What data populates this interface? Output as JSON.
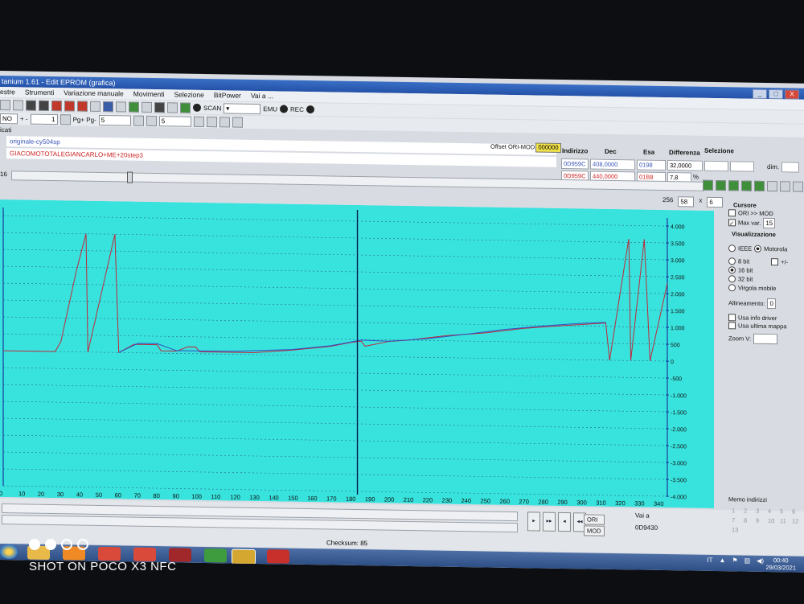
{
  "window": {
    "title": "tanium 1.61 - Edit EPROM (grafica)",
    "controls": [
      "_",
      "□",
      "X"
    ]
  },
  "menu": [
    "estre",
    "Strumenti",
    "Variazione manuale",
    "Movimenti",
    "Selezione",
    "BitPower",
    "Vai a ..."
  ],
  "toolbar1": {
    "scan_label": "SCAN",
    "emu_label": "EMU",
    "rec_label": "REC"
  },
  "toolbar2": {
    "mode_value": "NO",
    "plus_minus": "+ -",
    "step_value": "1",
    "pg_label": "Pg+ Pg-",
    "pg_value": "5",
    "field3_value": "5"
  },
  "section_label": "icati",
  "files": {
    "ori": "originale-cy504sp",
    "mod": "GIACOMOTOTALEGIANCARLO+ME+20step3"
  },
  "offset": {
    "label": "Offset ORI-MOD",
    "value": "000000"
  },
  "table": {
    "headers": [
      "Indirizzo",
      "Dec",
      "Esa",
      "Differenza"
    ],
    "rows": [
      {
        "addr": "0D959C",
        "dec": "408,0000",
        "esa": "0198",
        "diff": "32,0000"
      },
      {
        "addr": "0D959C",
        "dec": "440,0000",
        "esa": "01B8",
        "diff": "7,8",
        "pct": "%"
      }
    ]
  },
  "selezione": {
    "title": "Selezione",
    "dim_label": "dim."
  },
  "slider_label": "16",
  "zoom": {
    "a": "256",
    "b": "58",
    "x": "x",
    "c": "6"
  },
  "right_panel": {
    "cursore_title": "Cursore",
    "ori_mod": "ORI >> MOD",
    "max_var_label": "Max var.",
    "max_var_value": "15",
    "visual_title": "Visualizzazione",
    "ieee": "IEEE",
    "motorola": "Motorola",
    "bit8": "8 bit",
    "bit16": "16 bit",
    "bit32": "32 bit",
    "plusminus": "+/-",
    "virgola": "Virgola mobile",
    "allineamento_label": "Allineamento:",
    "allineamento_value": "0",
    "usa_info": "Usa info driver",
    "usa_ultima": "Usa ultima mappa",
    "zoom_v": "Zoom V:"
  },
  "bottom": {
    "ori_btn": "ORI",
    "mod_btn": "MOD",
    "vai_a_label": "Vai a",
    "vai_a_value": "0D9430",
    "memo_title": "Memo indirizzi",
    "memo_numbers": [
      "1",
      "2",
      "3",
      "4",
      "5",
      "6",
      "7",
      "8",
      "9",
      "10",
      "11",
      "12",
      "13"
    ],
    "checksum": "Checksum: 85"
  },
  "taskbar": {
    "lang": "IT",
    "time": "00:40",
    "date": "29/03/2021"
  },
  "watermark": "SHOT ON POCO X3 NFC",
  "chart_data": {
    "type": "line",
    "x_ticks": [
      0,
      10,
      20,
      30,
      40,
      50,
      60,
      70,
      80,
      90,
      100,
      110,
      120,
      130,
      140,
      150,
      160,
      170,
      180,
      190,
      200,
      210,
      220,
      230,
      240,
      250,
      260,
      270,
      280,
      290,
      300,
      310,
      320,
      330,
      340
    ],
    "y_right_ticks": [
      "4.000",
      "3.500",
      "3.000",
      "2.500",
      "2.000",
      "1.500",
      "1.000",
      "500",
      "0",
      "-500",
      "-1.000",
      "-1.500",
      "-2.000",
      "-2.500",
      "-3.000",
      "-3.500",
      "-4.000"
    ],
    "ylim": [
      -4000,
      4000
    ],
    "xlim": [
      0,
      345
    ],
    "cursor_x": 184,
    "series": [
      {
        "color": "#c0283a",
        "points": [
          [
            0,
            0
          ],
          [
            27,
            0
          ],
          [
            30,
            300
          ],
          [
            38,
            2400
          ],
          [
            43,
            3500
          ],
          [
            44,
            0
          ],
          [
            58,
            3500
          ],
          [
            60,
            0
          ],
          [
            68,
            250
          ],
          [
            70,
            250
          ],
          [
            80,
            250
          ],
          [
            82,
            70
          ],
          [
            90,
            70
          ],
          [
            96,
            200
          ],
          [
            100,
            200
          ],
          [
            102,
            60
          ],
          [
            130,
            60
          ],
          [
            150,
            150
          ],
          [
            170,
            280
          ],
          [
            180,
            400
          ],
          [
            186,
            450
          ],
          [
            188,
            300
          ],
          [
            200,
            450
          ],
          [
            210,
            500
          ],
          [
            230,
            650
          ],
          [
            250,
            750
          ],
          [
            270,
            900
          ],
          [
            290,
            1000
          ],
          [
            313,
            1100
          ],
          [
            315,
            0
          ],
          [
            323,
            2900
          ],
          [
            325,
            3600
          ],
          [
            326,
            0
          ],
          [
            333,
            3600
          ],
          [
            336,
            0
          ],
          [
            345,
            2300
          ]
        ]
      },
      {
        "color": "#3050c0",
        "points": [
          [
            60,
            0
          ],
          [
            70,
            280
          ],
          [
            80,
            280
          ],
          [
            90,
            80
          ],
          [
            120,
            90
          ],
          [
            150,
            170
          ],
          [
            170,
            300
          ],
          [
            186,
            480
          ],
          [
            200,
            460
          ],
          [
            220,
            550
          ],
          [
            240,
            700
          ],
          [
            260,
            860
          ],
          [
            280,
            980
          ],
          [
            300,
            1080
          ],
          [
            313,
            1120
          ]
        ]
      }
    ]
  }
}
